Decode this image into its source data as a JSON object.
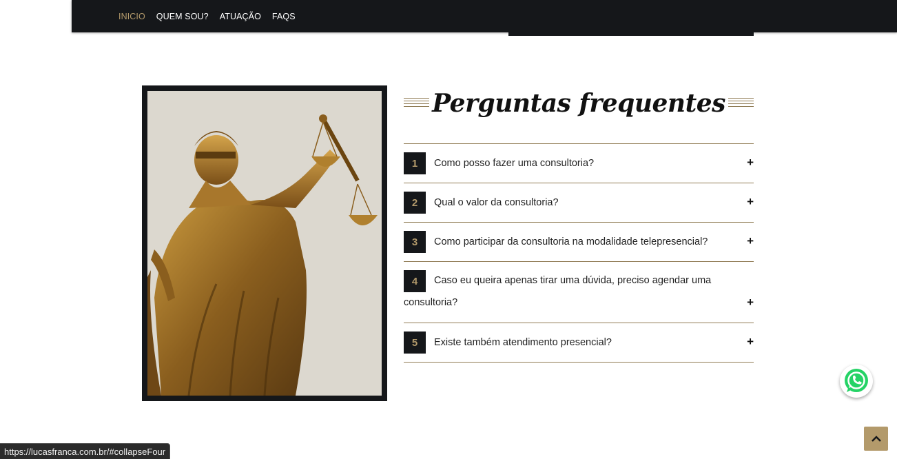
{
  "nav": {
    "items": [
      {
        "label": "INICIO",
        "active": true
      },
      {
        "label": "QUEM SOU?",
        "active": false
      },
      {
        "label": "ATUAÇÃO",
        "active": false
      },
      {
        "label": "FAQS",
        "active": false
      }
    ]
  },
  "faq": {
    "title": "Perguntas frequentes",
    "items": [
      {
        "number": "1",
        "question": "Como posso fazer uma consultoria?",
        "toggle": "+"
      },
      {
        "number": "2",
        "question": "Qual o valor da consultoria?",
        "toggle": "+"
      },
      {
        "number": "3",
        "question": "Como participar da consultoria na modalidade telepresencial?",
        "toggle": "+"
      },
      {
        "number": "4",
        "question": "Caso eu queira apenas tirar uma dúvida, preciso agendar uma consultoria?",
        "toggle": "+"
      },
      {
        "number": "5",
        "question": "Existe também atendimento presencial?",
        "toggle": "+"
      }
    ]
  },
  "image": {
    "subject": "lady-justice-statue"
  },
  "icons": {
    "whatsapp": "whatsapp-icon",
    "back_to_top": "chevron-up-icon"
  },
  "colors": {
    "dark": "#15171a",
    "accent": "#b39a6b",
    "whatsapp_green": "#25d366"
  },
  "status_bar": {
    "url": "https://lucasfranca.com.br/#collapseFour"
  }
}
